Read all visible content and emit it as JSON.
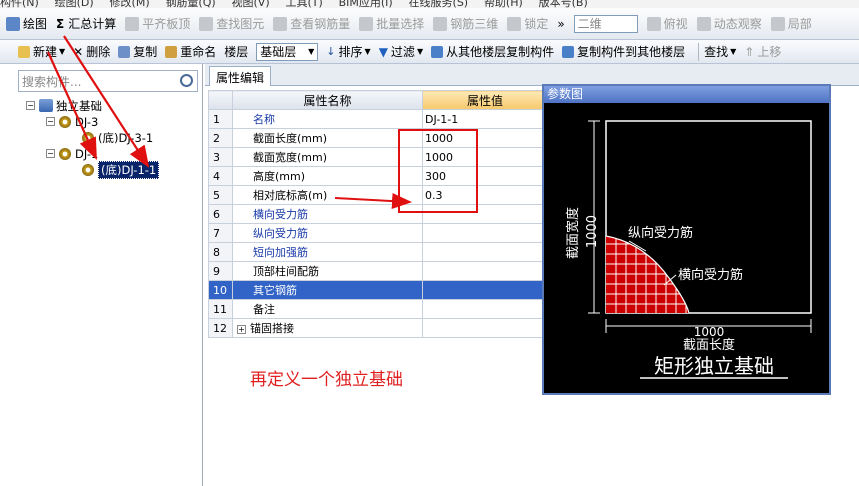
{
  "menubar": [
    "构件(N)",
    "绘图(D)",
    "修改(M)",
    "钢筋量(Q)",
    "视图(V)",
    "工具(T)",
    "BIM应用(I)",
    "在线服务(S)",
    "帮助(H)",
    "版本号(B)"
  ],
  "toolbar1": {
    "draw": "绘图",
    "summary": "汇总计算",
    "flush": "平齐板顶",
    "find": "查找图元",
    "view_rebar": "查看钢筋量",
    "batch": "批量选择",
    "rebar3d": "钢筋三维",
    "lock": "锁定",
    "more": "»",
    "view_mode": "二维",
    "top_view": "俯视",
    "dynamic": "动态观察",
    "local": "局部"
  },
  "toolbar2": {
    "new": "新建",
    "delete": "删除",
    "copy": "复制",
    "rename": "重命名",
    "floor_label": "楼层",
    "floor_value": "基础层",
    "sort": "排序",
    "filter": "过滤",
    "copy_from": "从其他楼层复制构件",
    "copy_to": "复制构件到其他楼层",
    "find": "查找",
    "up": "上移"
  },
  "left": {
    "search_placeholder": "搜索构件...",
    "tree": {
      "root": "独立基础",
      "dj3": "DJ-3",
      "dj3_child": "(底)DJ-3-1",
      "dj1": "DJ-1",
      "dj1_child": "(底)DJ-1-1"
    }
  },
  "tab": "属性编辑",
  "grid": {
    "col_name": "属性名称",
    "col_value": "属性值",
    "rows": [
      {
        "n": "1",
        "name": "名称",
        "value": "DJ-1-1",
        "blue": true
      },
      {
        "n": "2",
        "name": "截面长度(mm)",
        "value": "1000",
        "blue": false
      },
      {
        "n": "3",
        "name": "截面宽度(mm)",
        "value": "1000",
        "blue": false
      },
      {
        "n": "4",
        "name": "高度(mm)",
        "value": "300",
        "blue": false
      },
      {
        "n": "5",
        "name": "相对底标高(m)",
        "value": "0.3",
        "blue": false
      },
      {
        "n": "6",
        "name": "横向受力筋",
        "value": "",
        "blue": true
      },
      {
        "n": "7",
        "name": "纵向受力筋",
        "value": "",
        "blue": true
      },
      {
        "n": "8",
        "name": "短向加强筋",
        "value": "",
        "blue": true
      },
      {
        "n": "9",
        "name": "顶部柱间配筋",
        "value": "",
        "blue": false
      },
      {
        "n": "10",
        "name": "其它钢筋",
        "value": "",
        "blue": true
      },
      {
        "n": "11",
        "name": "备注",
        "value": "",
        "blue": false
      },
      {
        "n": "12",
        "name": "锚固搭接",
        "value": "",
        "blue": false
      }
    ]
  },
  "caption": "再定义一个独立基础",
  "ref_panel": {
    "title": "参数图",
    "width_label": "截面宽度",
    "width_value": "1000",
    "length_value": "1000",
    "length_label": "截面长度",
    "long_bar": "纵向受力筋",
    "trans_bar": "横向受力筋",
    "figure_title": "矩形独立基础"
  },
  "colors": {
    "accent": "#3164c6",
    "annotation": "#e01010",
    "rebar": "#cc0000"
  }
}
